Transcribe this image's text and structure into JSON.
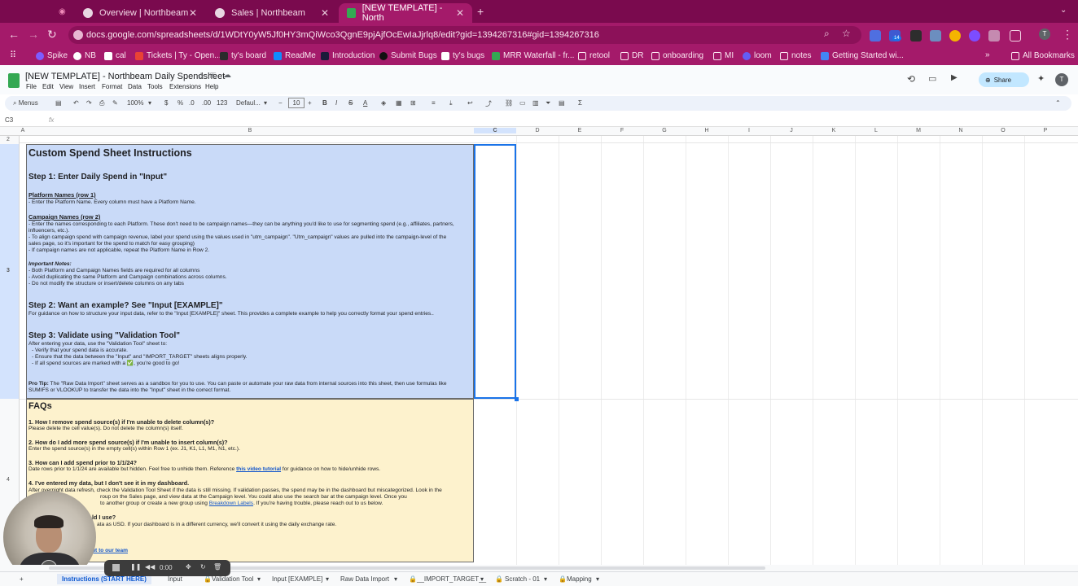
{
  "browser": {
    "tabs": [
      {
        "label": "Overview | Northbeam"
      },
      {
        "label": "Sales | Northbeam"
      },
      {
        "label": "[NEW TEMPLATE] - North"
      }
    ],
    "url": "docs.google.com/spreadsheets/d/1WDtY0yW5Jf0HY3mQiWco3QgnE9pjAjfOcEwIaJjrlq8/edit?gid=1394267316#gid=1394267316",
    "extension_badge": "14",
    "profile_initial": "T",
    "bookmarks": [
      "Spike",
      "NB",
      "cal",
      "Tickets | Ty - Open...",
      "ty's board",
      "ReadMe",
      "Introduction",
      "Submit Bugs",
      "ty's bugs",
      "MRR Waterfall - fr...",
      "retool",
      "DR",
      "onboarding",
      "MI",
      "loom",
      "notes",
      "Getting Started wi..."
    ],
    "all_bookmarks": "All Bookmarks"
  },
  "sheets": {
    "title": "[NEW TEMPLATE] - Northbeam Daily Spendsheet",
    "menus": [
      "File",
      "Edit",
      "View",
      "Insert",
      "Format",
      "Data",
      "Tools",
      "Extensions",
      "Help"
    ],
    "share": "Share",
    "avatar": "T",
    "toolbar": {
      "search": "Menus",
      "zoom": "100%",
      "currency": "$",
      "percent": "%",
      "decimals_down": ".0",
      "decimals_up": ".00",
      "number_format": "123",
      "font": "Defaul...",
      "font_size": "10"
    },
    "cell_ref": "C3",
    "fx": "fx",
    "columns": [
      "A",
      "B",
      "C",
      "D",
      "E",
      "F",
      "G",
      "H",
      "I",
      "J",
      "K",
      "L",
      "M",
      "N",
      "O",
      "P"
    ],
    "rows": [
      "2",
      "3",
      "4"
    ]
  },
  "content": {
    "title": "Custom Spend Sheet Instructions",
    "step1": "Step 1: Enter Daily Spend in \"Input\"",
    "platform_heading": "Platform Names (row 1)",
    "platform_1": "- Enter the Platform Name. Every column must have a Platform Name.",
    "campaign_heading": "Campaign Names (row 2)",
    "campaign_1": "- Enter the names corresponding to each Platform. These don't need to be campaign names—they can be anything you'd like to use for segmenting spend (e.g., affiliates, partners,",
    "campaign_2": "influencers, etc.).",
    "campaign_3": "- To align campaign spend with campaign revenue, label your spend using the values used in \"utm_campaign\". \"Utm_campaign\" values are pulled into the campaign-level of the",
    "campaign_4": "sales page, so it's important for the spend to match for easy grouping)",
    "campaign_5": "- If campaign names are not applicable, repeat the Platform Name in Row 2.",
    "notes_heading": "Important Notes:",
    "notes_1": "- Both Platform and Campaign Names fields are required for all columns",
    "notes_2": "- Avoid duplicating the same Platform and Campaign combinations across columns.",
    "notes_3": "- Do not modify the structure or insert/delete columns on any tabs",
    "step2": "Step 2: Want an example? See \"Input [EXAMPLE]\"",
    "step2_text": "For guidance on how to structure your input data, refer to the \"Input [EXAMPLE]\" sheet. This provides a complete example to help you correctly format your spend entries..",
    "step3": "Step 3: Validate using \"Validation Tool\"",
    "step3_1": "After entering your data, use the \"Validation Tool\" sheet to:",
    "step3_2": "- Verify that your spend data is accurate.",
    "step3_3": "- Ensure that the data between the \"Input\" and \"IMPORT_TARGET\" sheets aligns properly.",
    "step3_4": "- If all spend sources are marked with a ✅, you're good to go!",
    "protip_label": "Pro Tip:",
    "protip_1": " The \"Raw Data Import\" sheet serves as a sandbox for you to use. You can paste or automate your raw data from internal sources into this sheet, then use formulas like",
    "protip_2": "SUMIFS or VLOOKUP to transfer the data into the \"Input\" sheet in the correct format.",
    "faqs": "FAQs",
    "q1": "1. How I remove spend source(s) if I'm unable to delete column(s)?",
    "a1": "Please delete the cell value(s). Do not delete the column(s) itself.",
    "q2": "2. How do I add more spend source(s) if I'm unable to insert column(s)?",
    "a2": "Enter the spend source(s) in the empty cell(s) within Row 1 (ex. J1, K1, L1, M1, N1, etc.).",
    "q3": "3. How can I add spend prior to 1/1/24?",
    "a3_pre": "Date rows prior to 1/1/24 are available but hidden. Feel free to unhide them. Reference ",
    "a3_link": "this video tutorial",
    "a3_post": " for guidance on how to hide/unhide rows.",
    "q4": "4. I've entered my data, but I don't see it in my dashboard.",
    "a4_1": "After overnight data refresh, check the Validation Tool Sheet if the data is still missing. If validation passes, the spend may be in the dashboard but miscategorized. Look in the",
    "a4_2": "roup on the Sales page, and view data at the Campaign level. You could also use the search bar at the campaign level. Once you",
    "a4_3_pre": "to another group or create a new group using ",
    "a4_3_link": "Breakdown Labels",
    "a4_3_post": ". If you're having trouble, please reach out to us below.",
    "q5": "ld I use?",
    "a5": "ata as USD. If your dashboard is in a different currency, we'll convert it using the daily exchange rate.",
    "contact": "out to our team"
  },
  "sheet_tabs": [
    "Instructions (START HERE)",
    "Input",
    "Validation Tool",
    "Input [EXAMPLE]",
    "Raw Data Import",
    "__IMPORT_TARGET__",
    "Scratch - 01",
    "Mapping"
  ],
  "player": {
    "time": "0:00"
  },
  "colors": {
    "brand": "#a41a6a",
    "blue_block": "#c9daf8",
    "yellow_block": "#fdf2cd",
    "selection": "#1a73e8"
  }
}
